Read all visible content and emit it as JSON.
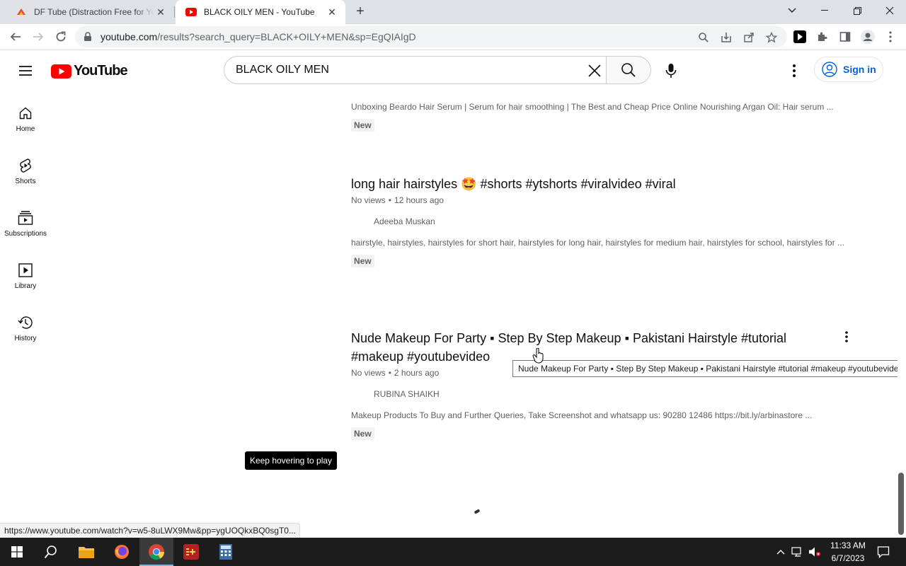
{
  "browser": {
    "tabs": [
      {
        "title": "DF Tube (Distraction Free for YouTube)",
        "active": false
      },
      {
        "title": "BLACK OILY MEN - YouTube",
        "active": true
      }
    ],
    "url_host": "youtube.com",
    "url_rest": "/results?search_query=BLACK+OILY+MEN&sp=EgQIAIgD",
    "status_url": "https://www.youtube.com/watch?v=w5-8uLWX9Mw&pp=ygUOQkxBQ0sgT0..."
  },
  "masthead": {
    "logo_text": "YouTube",
    "search_query": "BLACK OILY MEN",
    "signin_label": "Sign in"
  },
  "guide": {
    "items": [
      {
        "label": "Home",
        "icon": "home-icon"
      },
      {
        "label": "Shorts",
        "icon": "shorts-icon"
      },
      {
        "label": "Subscriptions",
        "icon": "subscriptions-icon"
      },
      {
        "label": "Library",
        "icon": "library-icon"
      },
      {
        "label": "History",
        "icon": "history-icon"
      }
    ]
  },
  "results": [
    {
      "description": "Unboxing Beardo Hair Serum | Serum for hair smoothing | The Best and Cheap Price Online Nourishing Argan Oil: Hair serum ...",
      "badge": "New"
    },
    {
      "title": "long hair hairstyles 🤩 #shorts #ytshorts #viralvideo #viral",
      "views": "No views",
      "age": "12 hours ago",
      "channel": "Adeeba Muskan",
      "description": "hairstyle, hairstyles, hairstyles for short hair, hairstyles for long hair, hairstyles for medium hair, hairstyles for school, hairstyles for ...",
      "badge": "New"
    },
    {
      "title_line1": "Nude Makeup For Party ▪ Step By Step Makeup ▪ Pakistani Hairstyle #tutorial",
      "title_line2": "#makeup #youtubevideo",
      "views": "No views",
      "age": "2 hours ago",
      "channel": "RUBINA SHAIKH",
      "description": "Makeup Products To Buy and Further Queries, Take Screenshot and whatsapp us: 90280 12486 https://bit.ly/arbinastore ...",
      "badge": "New"
    }
  ],
  "tooltip": "Nude Makeup For Party ▪ Step By Step Makeup ▪ Pakistani Hairstyle #tutorial #makeup #youtubevideo",
  "hover_hint": "Keep hovering to play",
  "taskbar": {
    "time": "11:33 AM",
    "date": "6/7/2023"
  },
  "colors": {
    "youtube_red": "#ff0000",
    "link_blue": "#065fd4",
    "taskbar": "#1c1c1c"
  }
}
